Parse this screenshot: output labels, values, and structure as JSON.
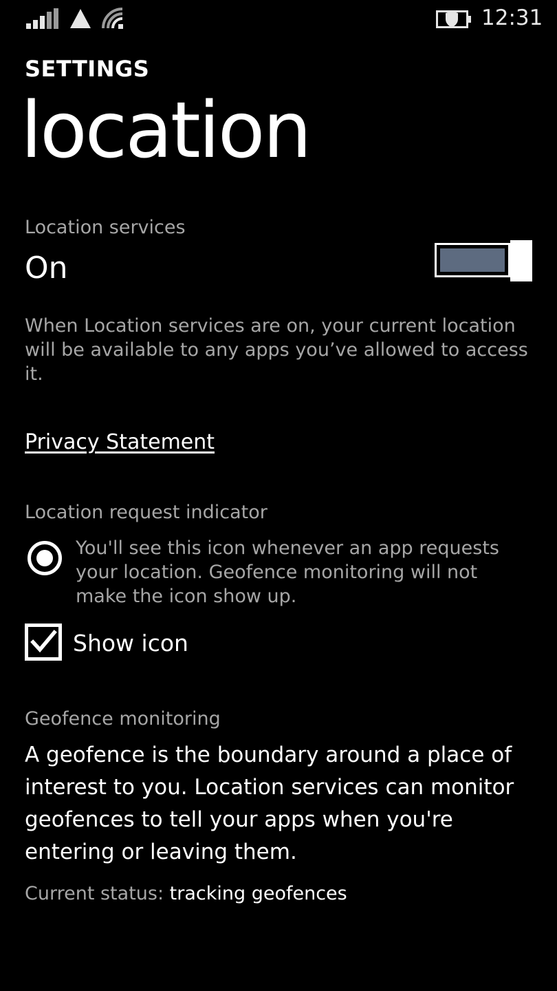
{
  "status_bar": {
    "time": "12:31",
    "icons": [
      "signal-strength-icon",
      "no-sim-triangle-icon",
      "wifi-icon",
      "battery-saver-icon"
    ]
  },
  "header": {
    "app_title": "SETTINGS",
    "page_title": "location"
  },
  "location_services": {
    "label": "Location services",
    "state": "On",
    "toggle_on": true,
    "toggle_color": "#5d6b80",
    "description": "When Location services are on, your current location will be available to any apps you’ve allowed to access it."
  },
  "privacy": {
    "link_text": "Privacy Statement"
  },
  "request_indicator": {
    "label": "Location request indicator",
    "description": "You'll see this icon whenever an app requests your location. Geofence monitoring will not make the icon show up.",
    "show_icon_label": "Show icon",
    "show_icon_checked": true
  },
  "geofence": {
    "label": "Geofence monitoring",
    "description": "A geofence is the boundary around a place of interest to you. Location services can monitor geofences to tell your apps when you're entering or leaving them.",
    "status_prefix": "Current status:",
    "status_value": "tracking geofences"
  },
  "colors": {
    "background": "#000000",
    "foreground": "#ffffff",
    "secondary_text": "#a6a6a6",
    "accent": "#5d6b80"
  }
}
